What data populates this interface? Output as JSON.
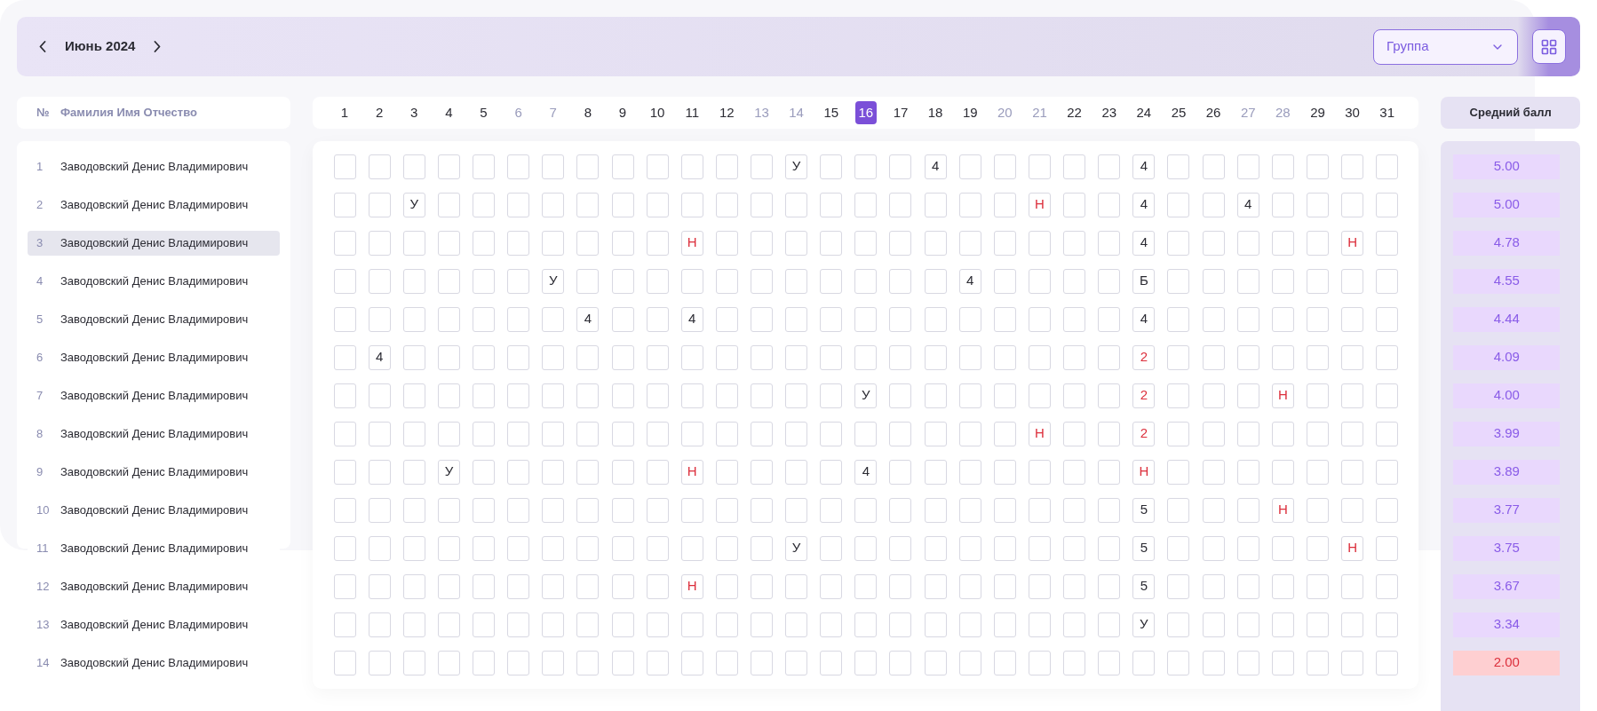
{
  "header": {
    "month": "Июнь 2024",
    "group_select": {
      "placeholder": "Группа"
    }
  },
  "columns": {
    "number": "№",
    "name": "Фамилия Имя Отчество",
    "average": "Средний балл"
  },
  "days": [
    {
      "label": "1",
      "weekend": false,
      "selected": false
    },
    {
      "label": "2",
      "weekend": false,
      "selected": false
    },
    {
      "label": "3",
      "weekend": false,
      "selected": false
    },
    {
      "label": "4",
      "weekend": false,
      "selected": false
    },
    {
      "label": "5",
      "weekend": false,
      "selected": false
    },
    {
      "label": "6",
      "weekend": true,
      "selected": false
    },
    {
      "label": "7",
      "weekend": true,
      "selected": false
    },
    {
      "label": "8",
      "weekend": false,
      "selected": false
    },
    {
      "label": "9",
      "weekend": false,
      "selected": false
    },
    {
      "label": "10",
      "weekend": false,
      "selected": false
    },
    {
      "label": "11",
      "weekend": false,
      "selected": false
    },
    {
      "label": "12",
      "weekend": false,
      "selected": false
    },
    {
      "label": "13",
      "weekend": true,
      "selected": false
    },
    {
      "label": "14",
      "weekend": true,
      "selected": false
    },
    {
      "label": "15",
      "weekend": false,
      "selected": false
    },
    {
      "label": "16",
      "weekend": false,
      "selected": true
    },
    {
      "label": "17",
      "weekend": false,
      "selected": false
    },
    {
      "label": "18",
      "weekend": false,
      "selected": false
    },
    {
      "label": "19",
      "weekend": false,
      "selected": false
    },
    {
      "label": "20",
      "weekend": true,
      "selected": false
    },
    {
      "label": "21",
      "weekend": true,
      "selected": false
    },
    {
      "label": "22",
      "weekend": false,
      "selected": false
    },
    {
      "label": "23",
      "weekend": false,
      "selected": false
    },
    {
      "label": "24",
      "weekend": false,
      "selected": false
    },
    {
      "label": "25",
      "weekend": false,
      "selected": false
    },
    {
      "label": "26",
      "weekend": false,
      "selected": false
    },
    {
      "label": "27",
      "weekend": true,
      "selected": false
    },
    {
      "label": "28",
      "weekend": true,
      "selected": false
    },
    {
      "label": "29",
      "weekend": false,
      "selected": false
    },
    {
      "label": "30",
      "weekend": false,
      "selected": false
    },
    {
      "label": "31",
      "weekend": false,
      "selected": false
    }
  ],
  "students": [
    {
      "number": "1",
      "name": "Заводовский Денис Владимирович",
      "selected": false,
      "average": "5.00",
      "low": false,
      "cells": [
        {
          "empty": true
        },
        {
          "empty": true
        },
        {
          "empty": true
        },
        {
          "empty": true
        },
        {
          "empty": true
        },
        {
          "empty": true
        },
        {
          "empty": true
        },
        {
          "empty": true
        },
        {
          "empty": true
        },
        {
          "empty": true
        },
        {
          "empty": true
        },
        {
          "empty": true
        },
        {
          "empty": true
        },
        {
          "text": "У",
          "alert": false
        },
        {
          "empty": true
        },
        {
          "empty": true
        },
        {
          "empty": true
        },
        {
          "text": "4",
          "alert": false
        },
        {
          "empty": true
        },
        {
          "empty": true
        },
        {
          "empty": true
        },
        {
          "empty": true
        },
        {
          "empty": true
        },
        {
          "text": "4",
          "alert": false
        },
        {
          "empty": true
        },
        {
          "empty": true
        },
        {
          "empty": true
        },
        {
          "empty": true
        },
        {
          "empty": true
        },
        {
          "empty": true
        },
        {
          "empty": true
        }
      ]
    },
    {
      "number": "2",
      "name": "Заводовский Денис Владимирович",
      "selected": false,
      "average": "5.00",
      "low": false,
      "cells": [
        {
          "empty": true
        },
        {
          "empty": true
        },
        {
          "text": "У",
          "alert": false
        },
        {
          "empty": true
        },
        {
          "empty": true
        },
        {
          "empty": true
        },
        {
          "empty": true
        },
        {
          "empty": true
        },
        {
          "empty": true
        },
        {
          "empty": true
        },
        {
          "empty": true
        },
        {
          "empty": true
        },
        {
          "empty": true
        },
        {
          "empty": true
        },
        {
          "empty": true
        },
        {
          "empty": true
        },
        {
          "empty": true
        },
        {
          "empty": true
        },
        {
          "empty": true
        },
        {
          "empty": true
        },
        {
          "text": "Н",
          "alert": true
        },
        {
          "empty": true
        },
        {
          "empty": true
        },
        {
          "text": "4",
          "alert": false
        },
        {
          "empty": true
        },
        {
          "empty": true
        },
        {
          "text": "4",
          "alert": false
        },
        {
          "empty": true
        },
        {
          "empty": true
        },
        {
          "empty": true
        },
        {
          "empty": true
        }
      ]
    },
    {
      "number": "3",
      "name": "Заводовский Денис Владимирович",
      "selected": true,
      "average": "4.78",
      "low": false,
      "cells": [
        {
          "empty": true
        },
        {
          "empty": true
        },
        {
          "empty": true
        },
        {
          "empty": true
        },
        {
          "empty": true
        },
        {
          "empty": true
        },
        {
          "empty": true
        },
        {
          "empty": true
        },
        {
          "empty": true
        },
        {
          "empty": true
        },
        {
          "text": "Н",
          "alert": true
        },
        {
          "empty": true
        },
        {
          "empty": true
        },
        {
          "empty": true
        },
        {
          "empty": true
        },
        {
          "empty": true
        },
        {
          "empty": true
        },
        {
          "empty": true
        },
        {
          "empty": true
        },
        {
          "empty": true
        },
        {
          "empty": true
        },
        {
          "empty": true
        },
        {
          "empty": true
        },
        {
          "text": "4",
          "alert": false
        },
        {
          "empty": true
        },
        {
          "empty": true
        },
        {
          "empty": true
        },
        {
          "empty": true
        },
        {
          "empty": true
        },
        {
          "text": "Н",
          "alert": true
        },
        {
          "empty": true
        }
      ]
    },
    {
      "number": "4",
      "name": "Заводовский Денис Владимирович",
      "selected": false,
      "average": "4.55",
      "low": false,
      "cells": [
        {
          "empty": true
        },
        {
          "empty": true
        },
        {
          "empty": true
        },
        {
          "empty": true
        },
        {
          "empty": true
        },
        {
          "empty": true
        },
        {
          "text": "У",
          "alert": false
        },
        {
          "empty": true
        },
        {
          "empty": true
        },
        {
          "empty": true
        },
        {
          "empty": true
        },
        {
          "empty": true
        },
        {
          "empty": true
        },
        {
          "empty": true
        },
        {
          "empty": true
        },
        {
          "empty": true
        },
        {
          "empty": true
        },
        {
          "empty": true
        },
        {
          "text": "4",
          "alert": false
        },
        {
          "empty": true
        },
        {
          "empty": true
        },
        {
          "empty": true
        },
        {
          "empty": true
        },
        {
          "text": "Б",
          "alert": false
        },
        {
          "empty": true
        },
        {
          "empty": true
        },
        {
          "empty": true
        },
        {
          "empty": true
        },
        {
          "empty": true
        },
        {
          "empty": true
        },
        {
          "empty": true
        }
      ]
    },
    {
      "number": "5",
      "name": "Заводовский Денис Владимирович",
      "selected": false,
      "average": "4.44",
      "low": false,
      "cells": [
        {
          "empty": true
        },
        {
          "empty": true
        },
        {
          "empty": true
        },
        {
          "empty": true
        },
        {
          "empty": true
        },
        {
          "empty": true
        },
        {
          "empty": true
        },
        {
          "text": "4",
          "alert": false
        },
        {
          "empty": true
        },
        {
          "empty": true
        },
        {
          "text": "4",
          "alert": false
        },
        {
          "empty": true
        },
        {
          "empty": true
        },
        {
          "empty": true
        },
        {
          "empty": true
        },
        {
          "empty": true
        },
        {
          "empty": true
        },
        {
          "empty": true
        },
        {
          "empty": true
        },
        {
          "empty": true
        },
        {
          "empty": true
        },
        {
          "empty": true
        },
        {
          "empty": true
        },
        {
          "text": "4",
          "alert": false
        },
        {
          "empty": true
        },
        {
          "empty": true
        },
        {
          "empty": true
        },
        {
          "empty": true
        },
        {
          "empty": true
        },
        {
          "empty": true
        },
        {
          "empty": true
        }
      ]
    },
    {
      "number": "6",
      "name": "Заводовский Денис Владимирович",
      "selected": false,
      "average": "4.09",
      "low": false,
      "cells": [
        {
          "empty": true
        },
        {
          "text": "4",
          "alert": false
        },
        {
          "empty": true
        },
        {
          "empty": true
        },
        {
          "empty": true
        },
        {
          "empty": true
        },
        {
          "empty": true
        },
        {
          "empty": true
        },
        {
          "empty": true
        },
        {
          "empty": true
        },
        {
          "empty": true
        },
        {
          "empty": true
        },
        {
          "empty": true
        },
        {
          "empty": true
        },
        {
          "empty": true
        },
        {
          "empty": true
        },
        {
          "empty": true
        },
        {
          "empty": true
        },
        {
          "empty": true
        },
        {
          "empty": true
        },
        {
          "empty": true
        },
        {
          "empty": true
        },
        {
          "empty": true
        },
        {
          "text": "2",
          "alert": true
        },
        {
          "empty": true
        },
        {
          "empty": true
        },
        {
          "empty": true
        },
        {
          "empty": true
        },
        {
          "empty": true
        },
        {
          "empty": true
        },
        {
          "empty": true
        }
      ]
    },
    {
      "number": "7",
      "name": "Заводовский Денис Владимирович",
      "selected": false,
      "average": "4.00",
      "low": false,
      "cells": [
        {
          "empty": true
        },
        {
          "empty": true
        },
        {
          "empty": true
        },
        {
          "empty": true
        },
        {
          "empty": true
        },
        {
          "empty": true
        },
        {
          "empty": true
        },
        {
          "empty": true
        },
        {
          "empty": true
        },
        {
          "empty": true
        },
        {
          "empty": true
        },
        {
          "empty": true
        },
        {
          "empty": true
        },
        {
          "empty": true
        },
        {
          "empty": true
        },
        {
          "text": "У",
          "alert": false
        },
        {
          "empty": true
        },
        {
          "empty": true
        },
        {
          "empty": true
        },
        {
          "empty": true
        },
        {
          "empty": true
        },
        {
          "empty": true
        },
        {
          "empty": true
        },
        {
          "text": "2",
          "alert": true
        },
        {
          "empty": true
        },
        {
          "empty": true
        },
        {
          "empty": true
        },
        {
          "text": "Н",
          "alert": true
        },
        {
          "empty": true
        },
        {
          "empty": true
        },
        {
          "empty": true
        }
      ]
    },
    {
      "number": "8",
      "name": "Заводовский Денис Владимирович",
      "selected": false,
      "average": "3.99",
      "low": false,
      "cells": [
        {
          "empty": true
        },
        {
          "empty": true
        },
        {
          "empty": true
        },
        {
          "empty": true
        },
        {
          "empty": true
        },
        {
          "empty": true
        },
        {
          "empty": true
        },
        {
          "empty": true
        },
        {
          "empty": true
        },
        {
          "empty": true
        },
        {
          "empty": true
        },
        {
          "empty": true
        },
        {
          "empty": true
        },
        {
          "empty": true
        },
        {
          "empty": true
        },
        {
          "empty": true
        },
        {
          "empty": true
        },
        {
          "empty": true
        },
        {
          "empty": true
        },
        {
          "empty": true
        },
        {
          "text": "Н",
          "alert": true
        },
        {
          "empty": true
        },
        {
          "empty": true
        },
        {
          "text": "2",
          "alert": true
        },
        {
          "empty": true
        },
        {
          "empty": true
        },
        {
          "empty": true
        },
        {
          "empty": true
        },
        {
          "empty": true
        },
        {
          "empty": true
        },
        {
          "empty": true
        }
      ]
    },
    {
      "number": "9",
      "name": "Заводовский Денис Владимирович",
      "selected": false,
      "average": "3.89",
      "low": false,
      "cells": [
        {
          "empty": true
        },
        {
          "empty": true
        },
        {
          "empty": true
        },
        {
          "text": "У",
          "alert": false
        },
        {
          "empty": true
        },
        {
          "empty": true
        },
        {
          "empty": true
        },
        {
          "empty": true
        },
        {
          "empty": true
        },
        {
          "empty": true
        },
        {
          "text": "Н",
          "alert": true
        },
        {
          "empty": true
        },
        {
          "empty": true
        },
        {
          "empty": true
        },
        {
          "empty": true
        },
        {
          "text": "4",
          "alert": false
        },
        {
          "empty": true
        },
        {
          "empty": true
        },
        {
          "empty": true
        },
        {
          "empty": true
        },
        {
          "empty": true
        },
        {
          "empty": true
        },
        {
          "empty": true
        },
        {
          "text": "Н",
          "alert": true
        },
        {
          "empty": true
        },
        {
          "empty": true
        },
        {
          "empty": true
        },
        {
          "empty": true
        },
        {
          "empty": true
        },
        {
          "empty": true
        },
        {
          "empty": true
        }
      ]
    },
    {
      "number": "10",
      "name": "Заводовский Денис Владимирович",
      "selected": false,
      "average": "3.77",
      "low": false,
      "cells": [
        {
          "empty": true
        },
        {
          "empty": true
        },
        {
          "empty": true
        },
        {
          "empty": true
        },
        {
          "empty": true
        },
        {
          "empty": true
        },
        {
          "empty": true
        },
        {
          "empty": true
        },
        {
          "empty": true
        },
        {
          "empty": true
        },
        {
          "empty": true
        },
        {
          "empty": true
        },
        {
          "empty": true
        },
        {
          "empty": true
        },
        {
          "empty": true
        },
        {
          "empty": true
        },
        {
          "empty": true
        },
        {
          "empty": true
        },
        {
          "empty": true
        },
        {
          "empty": true
        },
        {
          "empty": true
        },
        {
          "empty": true
        },
        {
          "empty": true
        },
        {
          "text": "5",
          "alert": false
        },
        {
          "empty": true
        },
        {
          "empty": true
        },
        {
          "empty": true
        },
        {
          "text": "Н",
          "alert": true
        },
        {
          "empty": true
        },
        {
          "empty": true
        },
        {
          "empty": true
        }
      ]
    },
    {
      "number": "11",
      "name": "Заводовский Денис Владимирович",
      "selected": false,
      "average": "3.75",
      "low": false,
      "cells": [
        {
          "empty": true
        },
        {
          "empty": true
        },
        {
          "empty": true
        },
        {
          "empty": true
        },
        {
          "empty": true
        },
        {
          "empty": true
        },
        {
          "empty": true
        },
        {
          "empty": true
        },
        {
          "empty": true
        },
        {
          "empty": true
        },
        {
          "empty": true
        },
        {
          "empty": true
        },
        {
          "empty": true
        },
        {
          "text": "У",
          "alert": false
        },
        {
          "empty": true
        },
        {
          "empty": true
        },
        {
          "empty": true
        },
        {
          "empty": true
        },
        {
          "empty": true
        },
        {
          "empty": true
        },
        {
          "empty": true
        },
        {
          "empty": true
        },
        {
          "empty": true
        },
        {
          "text": "5",
          "alert": false
        },
        {
          "empty": true
        },
        {
          "empty": true
        },
        {
          "empty": true
        },
        {
          "empty": true
        },
        {
          "empty": true
        },
        {
          "text": "Н",
          "alert": true
        },
        {
          "empty": true
        }
      ]
    },
    {
      "number": "12",
      "name": "Заводовский Денис Владимирович",
      "selected": false,
      "average": "3.67",
      "low": false,
      "cells": [
        {
          "empty": true
        },
        {
          "empty": true
        },
        {
          "empty": true
        },
        {
          "empty": true
        },
        {
          "empty": true
        },
        {
          "empty": true
        },
        {
          "empty": true
        },
        {
          "empty": true
        },
        {
          "empty": true
        },
        {
          "empty": true
        },
        {
          "text": "Н",
          "alert": true
        },
        {
          "empty": true
        },
        {
          "empty": true
        },
        {
          "empty": true
        },
        {
          "empty": true
        },
        {
          "empty": true
        },
        {
          "empty": true
        },
        {
          "empty": true
        },
        {
          "empty": true
        },
        {
          "empty": true
        },
        {
          "empty": true
        },
        {
          "empty": true
        },
        {
          "empty": true
        },
        {
          "text": "5",
          "alert": false
        },
        {
          "empty": true
        },
        {
          "empty": true
        },
        {
          "empty": true
        },
        {
          "empty": true
        },
        {
          "empty": true
        },
        {
          "empty": true
        },
        {
          "empty": true
        }
      ]
    },
    {
      "number": "13",
      "name": "Заводовский Денис Владимирович",
      "selected": false,
      "average": "3.34",
      "low": false,
      "cells": [
        {
          "empty": true
        },
        {
          "empty": true
        },
        {
          "empty": true
        },
        {
          "empty": true
        },
        {
          "empty": true
        },
        {
          "empty": true
        },
        {
          "empty": true
        },
        {
          "empty": true
        },
        {
          "empty": true
        },
        {
          "empty": true
        },
        {
          "empty": true
        },
        {
          "empty": true
        },
        {
          "empty": true
        },
        {
          "empty": true
        },
        {
          "empty": true
        },
        {
          "empty": true
        },
        {
          "empty": true
        },
        {
          "empty": true
        },
        {
          "empty": true
        },
        {
          "empty": true
        },
        {
          "empty": true
        },
        {
          "empty": true
        },
        {
          "empty": true
        },
        {
          "text": "У",
          "alert": false
        },
        {
          "empty": true
        },
        {
          "empty": true
        },
        {
          "empty": true
        },
        {
          "empty": true
        },
        {
          "empty": true
        },
        {
          "empty": true
        },
        {
          "empty": true
        }
      ]
    },
    {
      "number": "14",
      "name": "Заводовский Денис Владимирович",
      "selected": false,
      "average": "2.00",
      "low": true,
      "cells": [
        {
          "empty": true
        },
        {
          "empty": true
        },
        {
          "empty": true
        },
        {
          "empty": true
        },
        {
          "empty": true
        },
        {
          "empty": true
        },
        {
          "empty": true
        },
        {
          "empty": true
        },
        {
          "empty": true
        },
        {
          "empty": true
        },
        {
          "empty": true
        },
        {
          "empty": true
        },
        {
          "empty": true
        },
        {
          "empty": true
        },
        {
          "empty": true
        },
        {
          "empty": true
        },
        {
          "empty": true
        },
        {
          "empty": true
        },
        {
          "empty": true
        },
        {
          "empty": true
        },
        {
          "empty": true
        },
        {
          "empty": true
        },
        {
          "empty": true
        },
        {
          "empty": true
        },
        {
          "empty": true
        },
        {
          "empty": true
        },
        {
          "empty": true
        },
        {
          "empty": true
        },
        {
          "empty": true
        },
        {
          "empty": true
        },
        {
          "empty": true
        }
      ]
    }
  ]
}
